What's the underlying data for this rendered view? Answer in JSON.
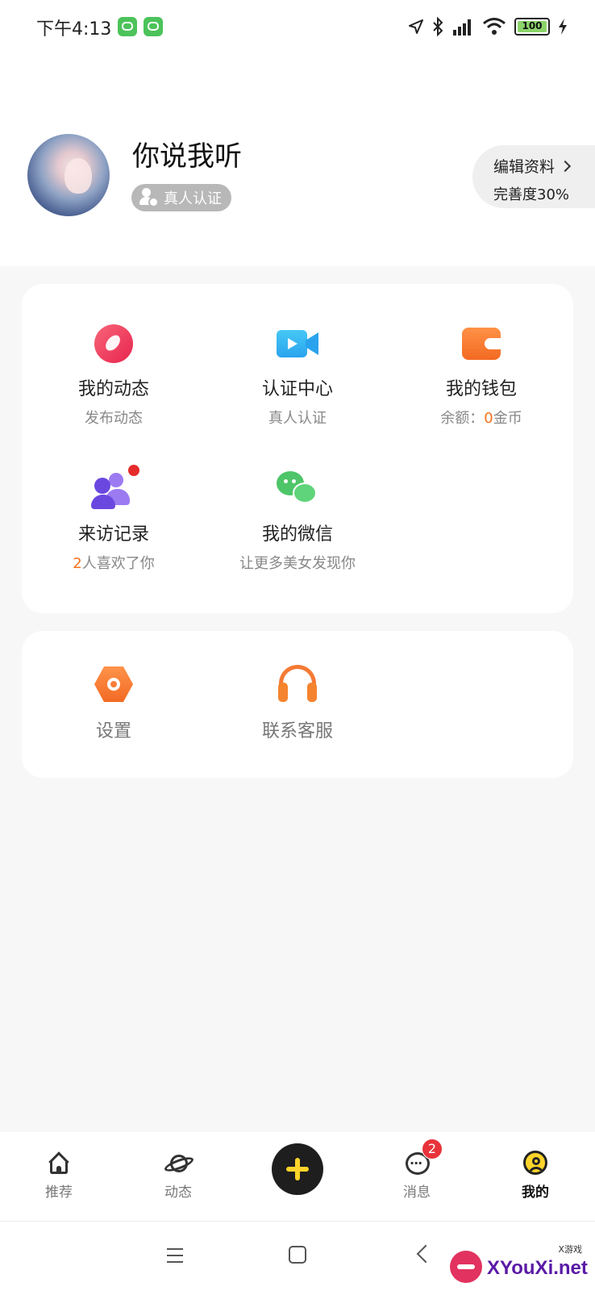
{
  "status_bar": {
    "time": "下午4:13",
    "battery": "100"
  },
  "profile": {
    "name": "你说我听",
    "verify_badge": "真人认证",
    "edit_label": "编辑资料",
    "completeness": "完善度30%"
  },
  "features": [
    {
      "label": "我的动态",
      "sub": "发布动态",
      "icon": "compass-icon"
    },
    {
      "label": "认证中心",
      "sub": "真人认证",
      "icon": "video-camera-icon"
    },
    {
      "label": "我的钱包",
      "sub_prefix": "余额：",
      "sub_highlight": "0",
      "sub_suffix": "金币",
      "icon": "wallet-icon"
    },
    {
      "label": "来访记录",
      "sub_highlight": "2",
      "sub_suffix": "人喜欢了你",
      "icon": "visitors-icon"
    },
    {
      "label": "我的微信",
      "sub": "让更多美女发现你",
      "icon": "wechat-icon"
    }
  ],
  "tools": [
    {
      "label": "设置",
      "icon": "settings-icon"
    },
    {
      "label": "联系客服",
      "icon": "headset-icon"
    }
  ],
  "tab_bar": {
    "tabs": [
      {
        "label": "推荐",
        "icon": "home-icon",
        "active": false
      },
      {
        "label": "动态",
        "icon": "planet-icon",
        "active": false
      },
      {
        "label": "",
        "icon": "plus-icon",
        "active": false
      },
      {
        "label": "消息",
        "icon": "message-icon",
        "active": false,
        "badge": "2"
      },
      {
        "label": "我的",
        "icon": "profile-icon",
        "active": true
      }
    ]
  },
  "watermark": {
    "brand": "XYouXi.net",
    "tag": "X游戏"
  },
  "colors": {
    "accent_orange": "#f5721b",
    "accent_yellow": "#ffd42a",
    "badge_red": "#e8333b"
  }
}
